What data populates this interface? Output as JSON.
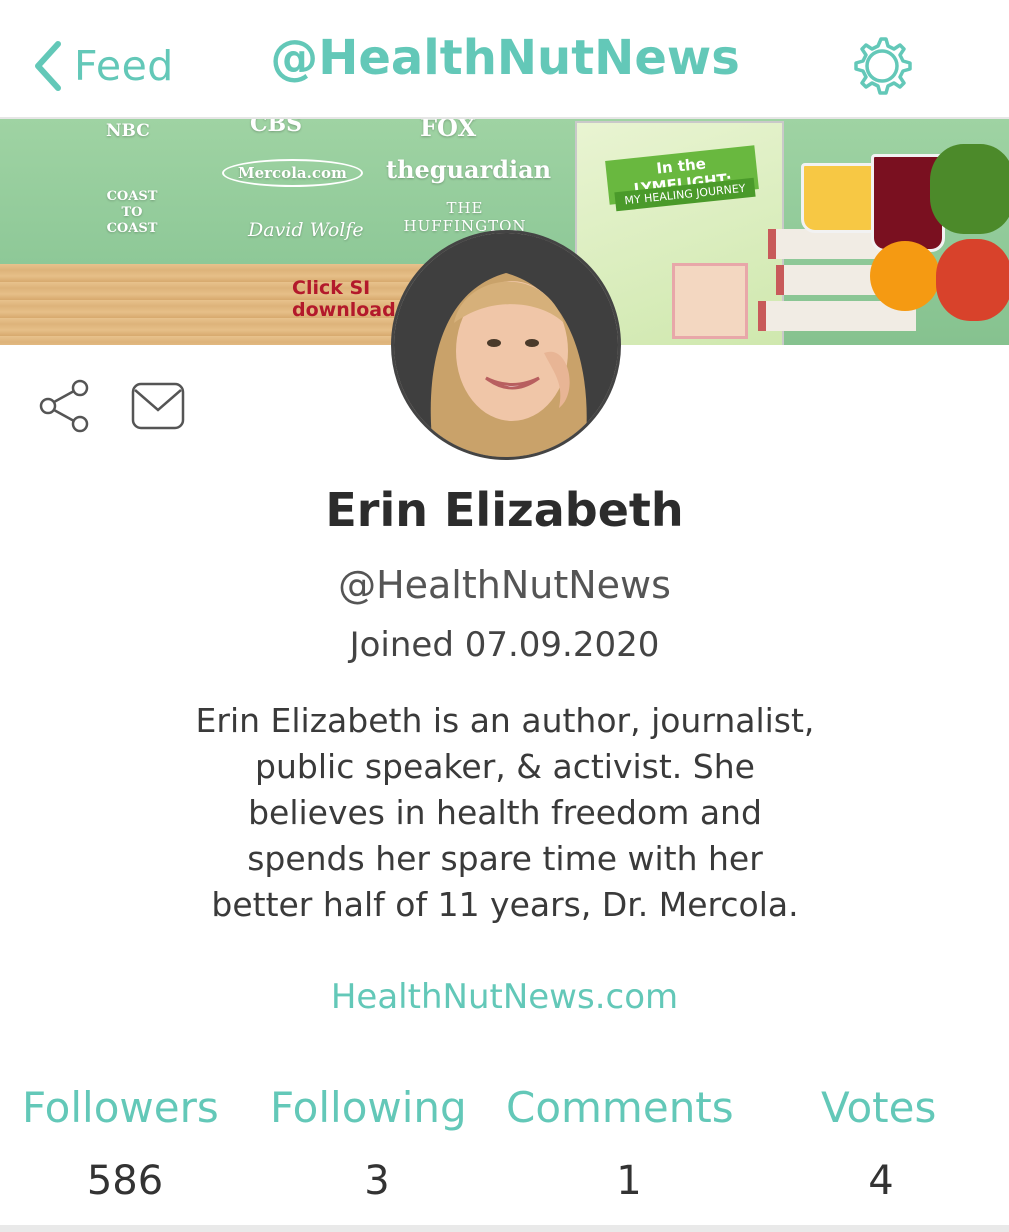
{
  "header": {
    "back_label": "Feed",
    "title": "@HealthNutNews",
    "accent_color": "#63c8b8"
  },
  "banner": {
    "brands": [
      "NBC",
      "CBS",
      "FOX",
      "Mercola.com",
      "theguardian",
      "COAST TO COAST",
      "David Wolfe",
      "THE HUFFINGTON"
    ],
    "click_text_line1": "Click SI",
    "click_text_line2": "download",
    "book_title": "In the LYMELIGHT:",
    "book_subtitle": "MY HEALING JOURNEY"
  },
  "profile": {
    "name": "Erin Elizabeth",
    "handle": "@HealthNutNews",
    "joined": "Joined 07.09.2020",
    "bio": "Erin Elizabeth is an author, journalist, public speaker, & activist. She believes in health freedom and spends her spare time with her better half of 11 years, Dr. Mercola.",
    "website": "HealthNutNews.com"
  },
  "stats": [
    {
      "label": "Followers",
      "value": "586"
    },
    {
      "label": "Following",
      "value": "3"
    },
    {
      "label": "Comments",
      "value": "1"
    },
    {
      "label": "Votes",
      "value": "4"
    }
  ],
  "icons": {
    "back": "chevron-left-icon",
    "settings": "gear-icon",
    "share": "share-icon",
    "message": "mail-icon"
  }
}
